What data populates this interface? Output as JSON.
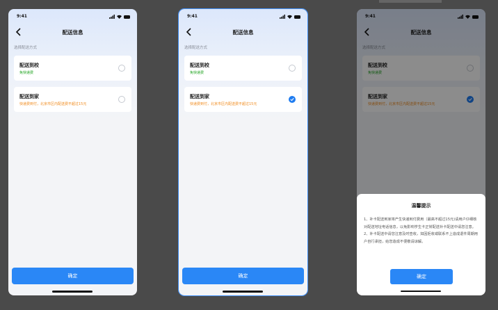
{
  "status": {
    "time": "9:41"
  },
  "nav": {
    "title": "配送信息"
  },
  "section_label": "选择配送方式",
  "options": [
    {
      "title": "配送到校",
      "subtitle": "免快递费"
    },
    {
      "title": "配送到家",
      "subtitle": "快递费到付，北京市区内配送费不超过15元"
    }
  ],
  "option2_subtitle_alt": "快递费到付，北京市区内配送费不超过15元",
  "confirm_label": "确定",
  "dialog": {
    "title": "温馨提示",
    "body": "1、补卡配送到家将产生快递到付费用（最高不超过15元)请用户仔细核对配送地址电话信息，以免影响学生卡正常配送补卡配送中请您注意。2、补卡配送中请您注意及时查收，如因拒收或联系不上造成退件周期用户自行承担，给您造成不便敬请谅解。",
    "confirm_label": "确定"
  },
  "colors": {
    "accent": "#2a87f6",
    "green": "#1ea31e",
    "orange": "#f08a1c"
  }
}
